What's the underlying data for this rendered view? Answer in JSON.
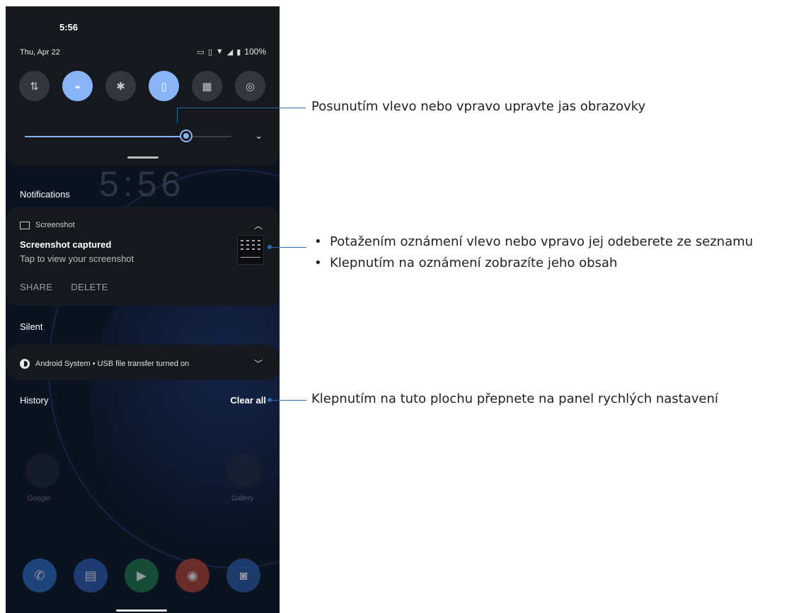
{
  "status_bar": {
    "time": "5:56",
    "date": "Thu, Apr 22",
    "battery": "100%"
  },
  "quick_tiles": [
    {
      "name": "mobile-data-tile",
      "icon": "data-arrows-icon",
      "glyph": "⇅",
      "on": false
    },
    {
      "name": "wifi-tile",
      "icon": "wifi-off-icon",
      "glyph": "◒",
      "on": true
    },
    {
      "name": "bluetooth-tile",
      "icon": "bluetooth-icon",
      "glyph": "✱",
      "on": false
    },
    {
      "name": "vibrate-tile",
      "icon": "vibrate-icon",
      "glyph": "▯",
      "on": true
    },
    {
      "name": "qr-scan-tile",
      "icon": "qr-code-icon",
      "glyph": "▦",
      "on": false
    },
    {
      "name": "hotspot-tile",
      "icon": "hotspot-icon",
      "glyph": "◎",
      "on": false
    }
  ],
  "brightness": {
    "level": 0.78
  },
  "lock_clock": "5:56",
  "notifications": {
    "header": "Notifications",
    "screenshot": {
      "app": "Screenshot",
      "title": "Screenshot captured",
      "text": "Tap to view your screenshot",
      "actions": [
        "SHARE",
        "DELETE"
      ]
    }
  },
  "silent": {
    "header": "Silent",
    "item": "Android System • USB file transfer turned on"
  },
  "history": {
    "label": "History",
    "clear_all": "Clear all"
  },
  "home_apps": [
    {
      "label": "Google"
    },
    {
      "label": "Gallery"
    }
  ],
  "callouts": {
    "brightness": "Posunutím vlevo nebo vpravo upravte jas obrazovky",
    "notification_items": [
      "Potažením oznámení vlevo nebo vpravo jej odeberete ze seznamu",
      "Klepnutím na oznámení zobrazíte jeho obsah"
    ],
    "clear_all": "Klepnutím na tuto plochu přepnete na panel rychlých nastavení"
  },
  "colors": {
    "accent": "#8ab4f8",
    "callout_line": "#2f6bb0",
    "panel": "#15181d"
  }
}
